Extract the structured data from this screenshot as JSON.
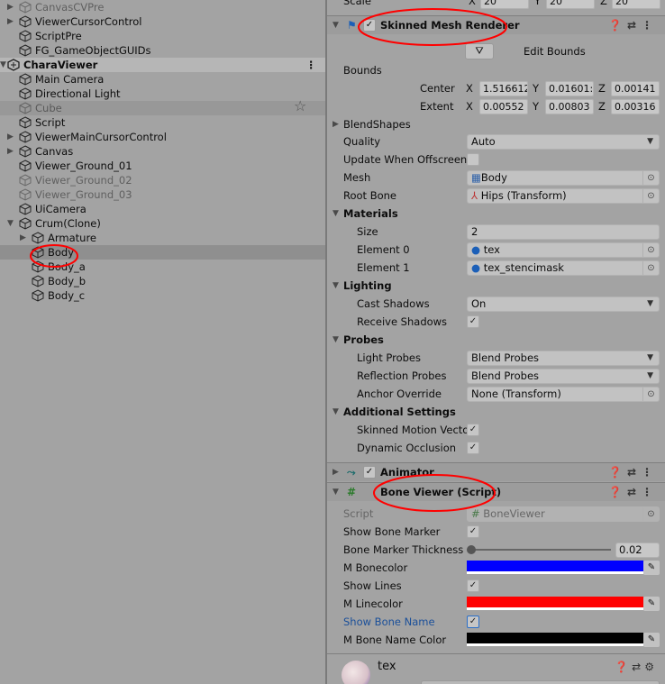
{
  "hierarchy": {
    "items": [
      {
        "label": "CanvasCVPre",
        "expand": "collapsed",
        "dim": true
      },
      {
        "label": "ViewerCursorControl",
        "expand": "collapsed"
      },
      {
        "label": "ScriptPre"
      },
      {
        "label": "FG_GameObjectGUIDs"
      },
      {
        "label": "CharaViewer",
        "scene": true
      },
      {
        "label": "Main Camera"
      },
      {
        "label": "Directional Light"
      },
      {
        "label": "Cube",
        "dim": true
      },
      {
        "label": "Script"
      },
      {
        "label": "ViewerMainCursorControl",
        "expand": "collapsed"
      },
      {
        "label": "Canvas",
        "expand": "collapsed"
      },
      {
        "label": "Viewer_Ground_01"
      },
      {
        "label": "Viewer_Ground_02",
        "dim": true
      },
      {
        "label": "Viewer_Ground_03",
        "dim": true
      },
      {
        "label": "UiCamera"
      },
      {
        "label": "Crum(Clone)",
        "expand": "expanded"
      },
      {
        "label": "Armature",
        "expand": "collapsed"
      },
      {
        "label": "Body",
        "selected": true
      },
      {
        "label": "Body_a"
      },
      {
        "label": "Body_b"
      },
      {
        "label": "Body_c"
      }
    ],
    "menu_glyph": "⋮",
    "star_glyph": "☆"
  },
  "inspector": {
    "transform_scale": {
      "label": "Scale",
      "x": "20",
      "y": "20",
      "z": "20"
    },
    "skinned_mesh_renderer": {
      "title": "Skinned Mesh Renderer",
      "enabled": true,
      "edit_bounds": "Edit Bounds",
      "bounds_label": "Bounds",
      "center_label": "Center",
      "extent_label": "Extent",
      "center": {
        "x": "1.516612",
        "y": "0.01601:",
        "z": "0.00141"
      },
      "extent": {
        "x": "0.00552",
        "y": "0.00803",
        "z": "0.00316"
      },
      "blendshapes": "BlendShapes",
      "quality_label": "Quality",
      "quality": "Auto",
      "update_offscreen_label": "Update When Offscreen",
      "update_offscreen": false,
      "mesh_label": "Mesh",
      "mesh": "Body",
      "root_bone_label": "Root Bone",
      "root_bone": "Hips (Transform)",
      "materials_label": "Materials",
      "size_label": "Size",
      "size": "2",
      "element0_label": "Element 0",
      "element0": "tex",
      "element1_label": "Element 1",
      "element1": "tex_stencimask",
      "lighting_label": "Lighting",
      "cast_shadows_label": "Cast Shadows",
      "cast_shadows": "On",
      "receive_shadows_label": "Receive Shadows",
      "receive_shadows": true,
      "probes_label": "Probes",
      "light_probes_label": "Light Probes",
      "light_probes": "Blend Probes",
      "reflection_probes_label": "Reflection Probes",
      "reflection_probes": "Blend Probes",
      "anchor_override_label": "Anchor Override",
      "anchor_override": "None (Transform)",
      "additional_label": "Additional Settings",
      "skinned_motion_label": "Skinned Motion Vecto",
      "skinned_motion": true,
      "dynamic_occlusion_label": "Dynamic Occlusion",
      "dynamic_occlusion": true
    },
    "animator": {
      "title": "Animator",
      "enabled": true
    },
    "bone_viewer": {
      "title": "Bone Viewer (Script)",
      "script_label": "Script",
      "script": "BoneViewer",
      "show_bone_marker_label": "Show Bone Marker",
      "show_bone_marker": true,
      "thickness_label": "Bone Marker Thickness",
      "thickness": "0.02",
      "thickness_fraction": 0.0,
      "bonecolor_label": "M Bonecolor",
      "bonecolor": "#0000ff",
      "show_lines_label": "Show Lines",
      "show_lines": true,
      "linecolor_label": "M Linecolor",
      "linecolor": "#ff0000",
      "show_bone_name_label": "Show Bone Name",
      "show_bone_name": true,
      "bone_name_color_label": "M Bone Name Color",
      "bone_name_color": "#000000"
    },
    "material": {
      "title": "tex"
    },
    "header_icons": {
      "help": "❓",
      "presets": "⇄",
      "menu": "⋮",
      "settings": "⚙"
    }
  },
  "annotations": {
    "color": "#ff0000"
  }
}
